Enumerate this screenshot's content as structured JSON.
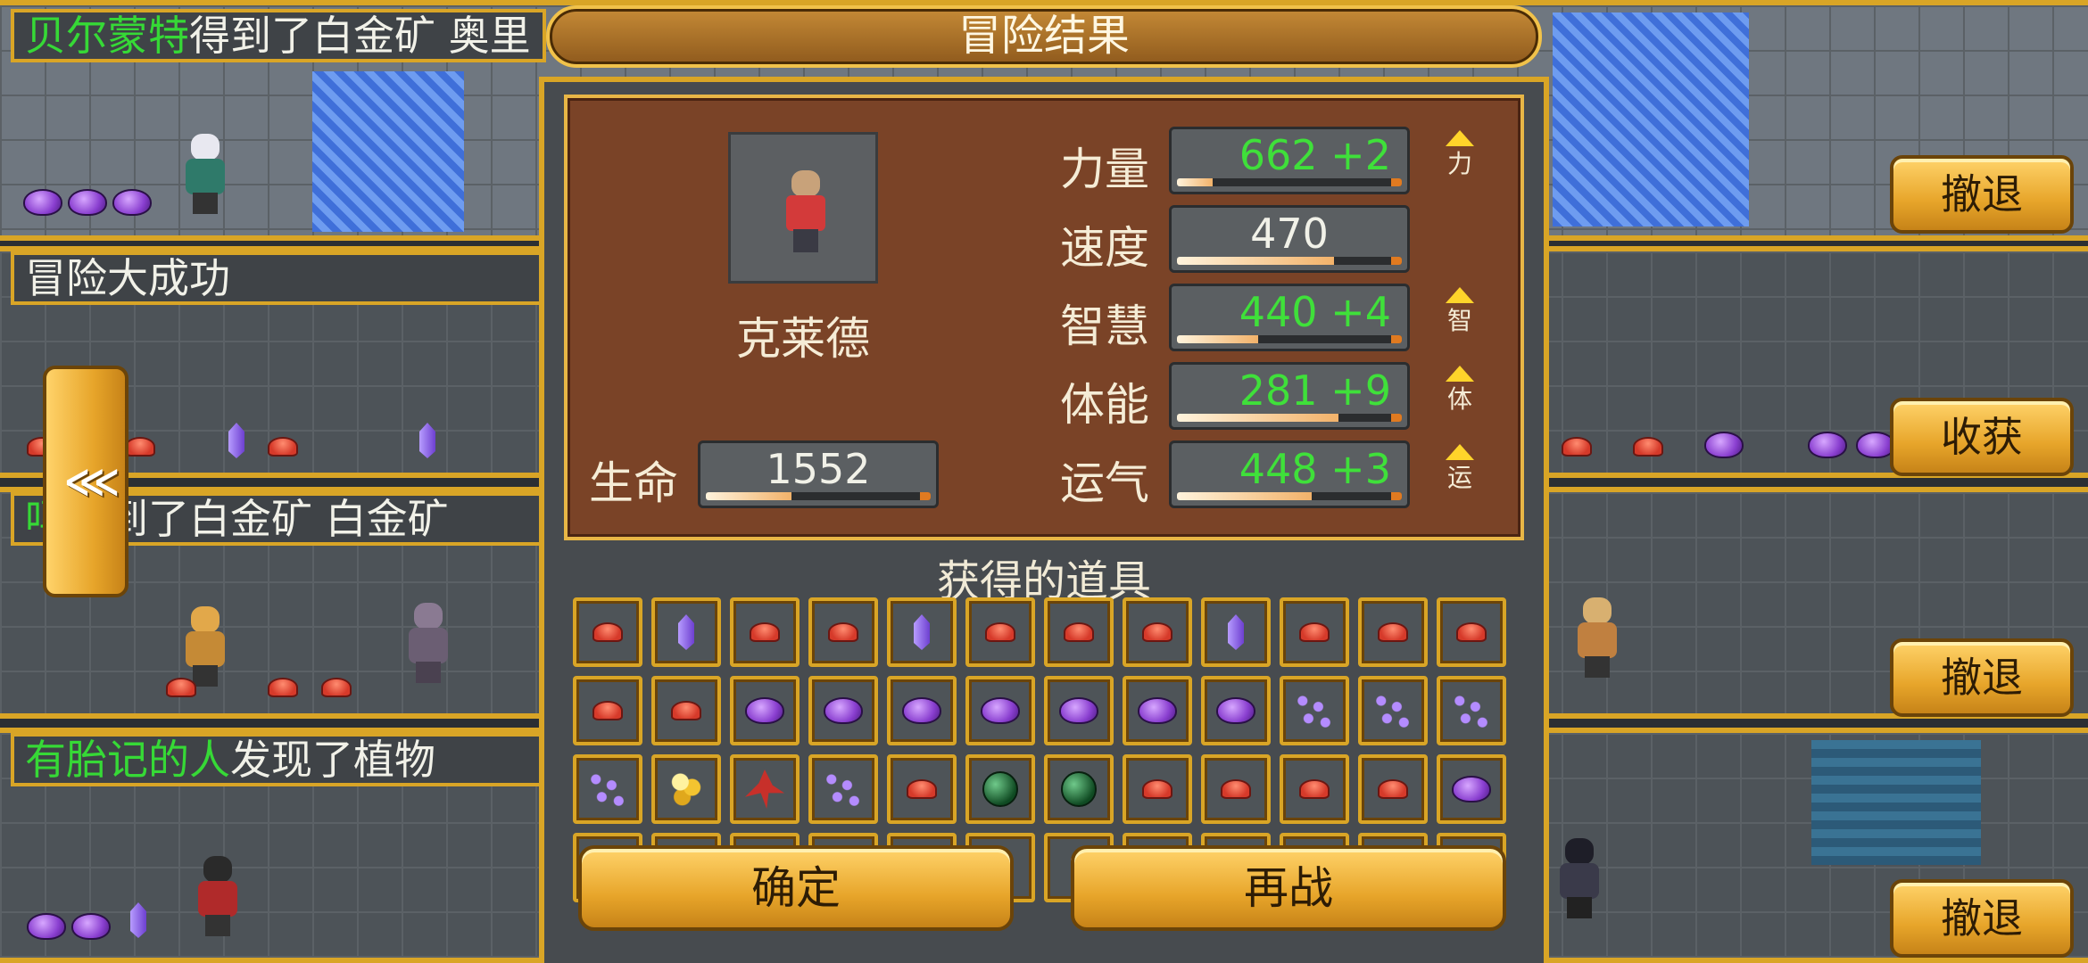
{
  "lanes": [
    {
      "header_highlight": "贝尔蒙特",
      "header_rest": "得到了白金矿  奥里",
      "button": "撤退"
    },
    {
      "header_highlight": "",
      "header_rest": "冒险大成功",
      "button": "收获"
    },
    {
      "header_highlight": "吗",
      "header_rest": "得到了白金矿  白金矿",
      "button": "撤退"
    },
    {
      "header_highlight": "有胎记的人",
      "header_rest": "发现了植物",
      "button": "撤退"
    }
  ],
  "back_button": "⋘",
  "modal": {
    "title": "冒险结果",
    "hero_name": "克莱德",
    "life_label": "生命",
    "life_value": "1552",
    "life_fill": 0.38,
    "stats": [
      {
        "label": "力量",
        "value": "662",
        "bonus": "+2",
        "fill": 0.16,
        "up": true,
        "up_char": "力"
      },
      {
        "label": "速度",
        "value": "470",
        "bonus": "",
        "fill": 0.7,
        "up": false,
        "up_char": ""
      },
      {
        "label": "智慧",
        "value": "440",
        "bonus": "+4",
        "fill": 0.36,
        "up": true,
        "up_char": "智"
      },
      {
        "label": "体能",
        "value": "281",
        "bonus": "+9",
        "fill": 0.72,
        "up": true,
        "up_char": "体"
      },
      {
        "label": "运气",
        "value": "448",
        "bonus": "+3",
        "fill": 0.6,
        "up": true,
        "up_char": "运"
      }
    ],
    "items_title": "获得的道具",
    "items": [
      [
        "ore",
        "crystal",
        "ore",
        "ore",
        "crystal",
        "ore",
        "ore",
        "ore",
        "crystal",
        "ore",
        "ore",
        "ore"
      ],
      [
        "ore",
        "ore",
        "gem",
        "gem",
        "gem",
        "gem",
        "gem",
        "gem",
        "gem",
        "beads",
        "beads",
        "beads"
      ],
      [
        "beads",
        "gold",
        "plant",
        "beads",
        "ore",
        "orb",
        "orb",
        "ore",
        "ore",
        "ore",
        "ore",
        "gem"
      ],
      [
        "gem",
        "gem",
        "gem",
        "gem",
        "gem",
        "crystal",
        "crystal",
        "gem",
        "ore",
        "ore",
        "ore",
        "ore"
      ]
    ],
    "confirm_button": "确定",
    "retry_button": "再战"
  },
  "colors": {
    "accent_gold": "#d9a526",
    "bonus_green": "#3fe03a",
    "panel_brown": "#7a4327"
  }
}
